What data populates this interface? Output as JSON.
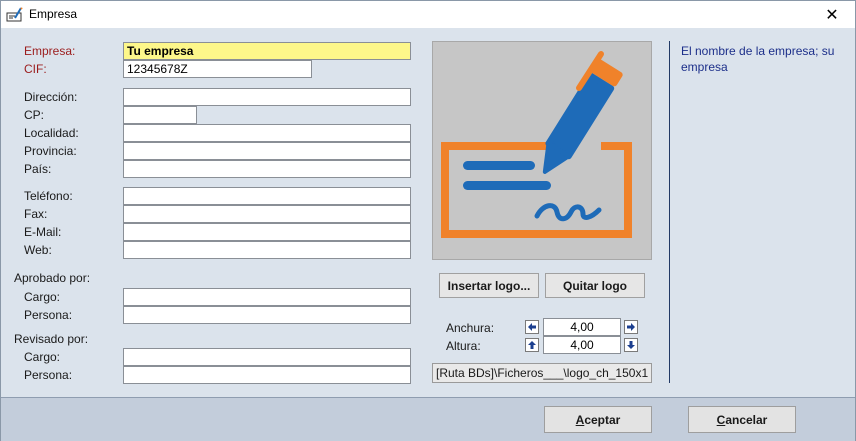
{
  "window": {
    "title": "Empresa",
    "close_glyph": "✕"
  },
  "company": {
    "name_label": "Empresa:",
    "name_value": "Tu empresa",
    "cif_label": "CIF:",
    "cif_value": "12345678Z"
  },
  "address": {
    "direccion_label": "Dirección:",
    "direccion_value": "",
    "cp_label": "CP:",
    "cp_value": "",
    "localidad_label": "Localidad:",
    "localidad_value": "",
    "provincia_label": "Provincia:",
    "provincia_value": "",
    "pais_label": "País:",
    "pais_value": ""
  },
  "contact": {
    "telefono_label": "Teléfono:",
    "telefono_value": "",
    "fax_label": "Fax:",
    "fax_value": "",
    "email_label": "E-Mail:",
    "email_value": "",
    "web_label": "Web:",
    "web_value": ""
  },
  "approved": {
    "section_label": "Aprobado por:",
    "cargo_label": "Cargo:",
    "cargo_value": "",
    "persona_label": "Persona:",
    "persona_value": ""
  },
  "reviewed": {
    "section_label": "Revisado por:",
    "cargo_label": "Cargo:",
    "cargo_value": "",
    "persona_label": "Persona:",
    "persona_value": ""
  },
  "logo": {
    "insert_label": "Insertar logo...",
    "remove_label": "Quitar logo",
    "width_label": "Anchura:",
    "width_value": "4,00",
    "height_label": "Altura:",
    "height_value": "4,00",
    "path_value": "[Ruta BDs]\\Ficheros___\\logo_ch_150x1",
    "icon": "signature-pen-icon",
    "colors": {
      "orange": "#f0822a",
      "blue": "#1e6bb8",
      "bg": "#c6c6c6"
    }
  },
  "help": {
    "text": "El nombre de la empresa; su empresa"
  },
  "footer": {
    "accept_accel": "A",
    "accept_rest": "ceptar",
    "cancel_accel": "C",
    "cancel_rest": "ancelar"
  }
}
